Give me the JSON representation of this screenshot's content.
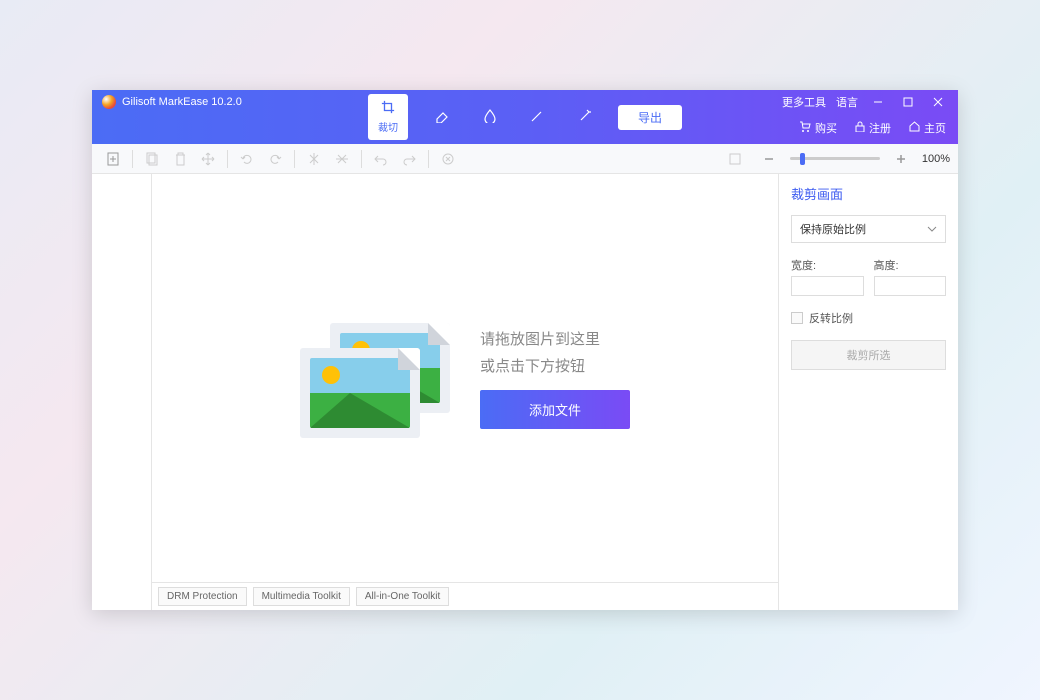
{
  "app": {
    "title": "Gilisoft MarkEase 10.2.0"
  },
  "titlebar_links": {
    "more_tools": "更多工具",
    "language": "语言"
  },
  "main_tabs": {
    "crop": "裁切",
    "export": "导出"
  },
  "header_links": {
    "buy": "购买",
    "register": "注册",
    "home": "主页"
  },
  "zoom": {
    "percent": "100%"
  },
  "dropzone": {
    "line1": "请拖放图片到这里",
    "line2": "或点击下方按钮",
    "add_button": "添加文件"
  },
  "bottom_tabs": {
    "drm": "DRM Protection",
    "multimedia": "Multimedia Toolkit",
    "allinone": "All-in-One Toolkit"
  },
  "right_panel": {
    "title": "裁剪画面",
    "ratio_dropdown": "保持原始比例",
    "width_label": "宽度:",
    "height_label": "高度:",
    "invert_ratio": "反转比例",
    "crop_button": "裁剪所选"
  }
}
